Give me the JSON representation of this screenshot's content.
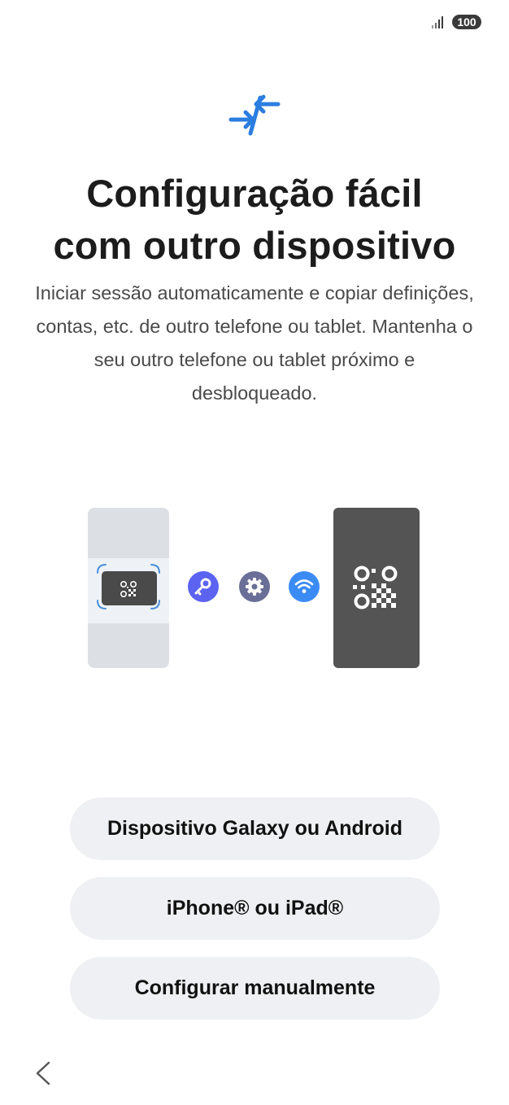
{
  "status_bar": {
    "battery": "100",
    "signal_icon": "signal-bars-icon"
  },
  "header": {
    "icon": "transfer-arrows-icon",
    "icon_color": "#2b7de0",
    "title_line1": "Configuração fácil",
    "title_line2": "com outro dispositivo",
    "description": "Iniciar sessão automaticamente e copiar definições, contas, etc. de outro telefone ou tablet. Mantenha o seu outro telefone ou tablet próximo e desbloqueado."
  },
  "illustration": {
    "icons": [
      "qr-code-icon",
      "key-icon",
      "settings-icon",
      "wifi-icon",
      "qr-code-icon"
    ],
    "colors": {
      "key": "#5b63f0",
      "settings": "#6a6f97",
      "wifi": "#3b8bf5",
      "phone_right": "#545454",
      "phone_left": "#dcdfe4"
    }
  },
  "options": {
    "galaxy_label": "Dispositivo Galaxy ou Android",
    "iphone_label": "iPhone® ou iPad®",
    "manual_label": "Configurar manualmente"
  },
  "navigation": {
    "back_icon": "chevron-left-icon"
  }
}
